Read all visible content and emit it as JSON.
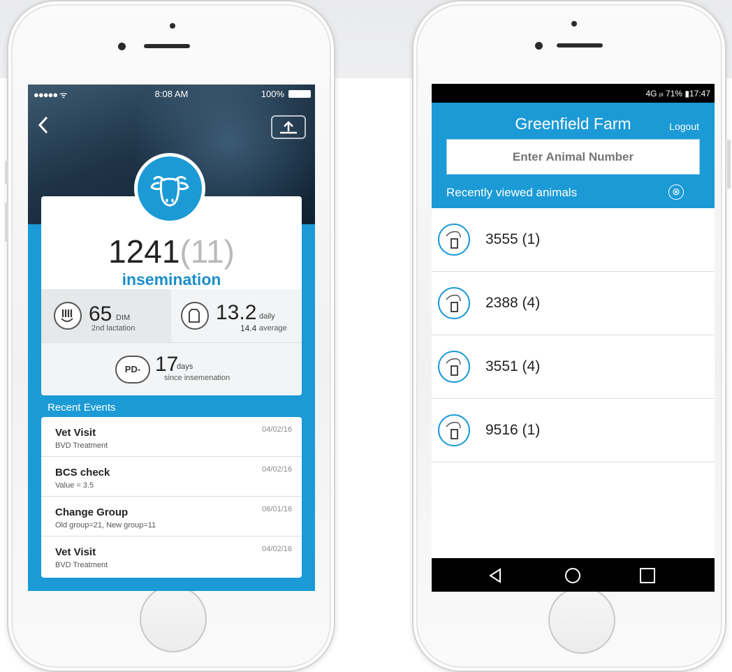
{
  "left_phone": {
    "status": {
      "signal": "●●●●● ᯤ",
      "time": "8:08 AM",
      "battery": "100%"
    },
    "share_icon": "share-icon",
    "animal_id": "1241",
    "lactation_number": "(11)",
    "event_type": "insemination",
    "dim": {
      "value": "65",
      "unit": "DIM",
      "sub": "2nd lactation"
    },
    "milk": {
      "value": "13.2",
      "unit": "daily",
      "sub_value": "14.4",
      "sub_label": "average"
    },
    "pd": {
      "label": "PD-",
      "value": "17",
      "unit": "days",
      "sub": "since insemenation"
    },
    "recent_events_title": "Recent Events",
    "events": [
      {
        "title": "Vet Visit",
        "desc": "BVD Treatment",
        "date": "04/02/16"
      },
      {
        "title": "BCS check",
        "desc": "Value = 3.5",
        "date": "04/02/16"
      },
      {
        "title": "Change Group",
        "desc": "Old group=21, New group=11",
        "date": "06/01/16"
      },
      {
        "title": "Vet Visit",
        "desc": "BVD Treatment",
        "date": "04/02/16"
      }
    ]
  },
  "right_phone": {
    "status": {
      "info": "4G ᵢₗₗ 71% ▮17:47"
    },
    "farm_name": "Greenfield Farm",
    "logout_label": "Logout",
    "search_placeholder": "Enter Animal Number",
    "recent_label": "Recently viewed animals",
    "clear_icon": "⊗",
    "animals": [
      {
        "label": "3555 (1)"
      },
      {
        "label": "2388 (4)"
      },
      {
        "label": "3551 (4)"
      },
      {
        "label": "9516 (1)"
      }
    ],
    "nav": {
      "back": "◁",
      "home": "○",
      "recents": "□"
    }
  },
  "colors": {
    "accent": "#1b9ad6",
    "text_dark": "#222222",
    "muted": "#b9b9b9"
  }
}
